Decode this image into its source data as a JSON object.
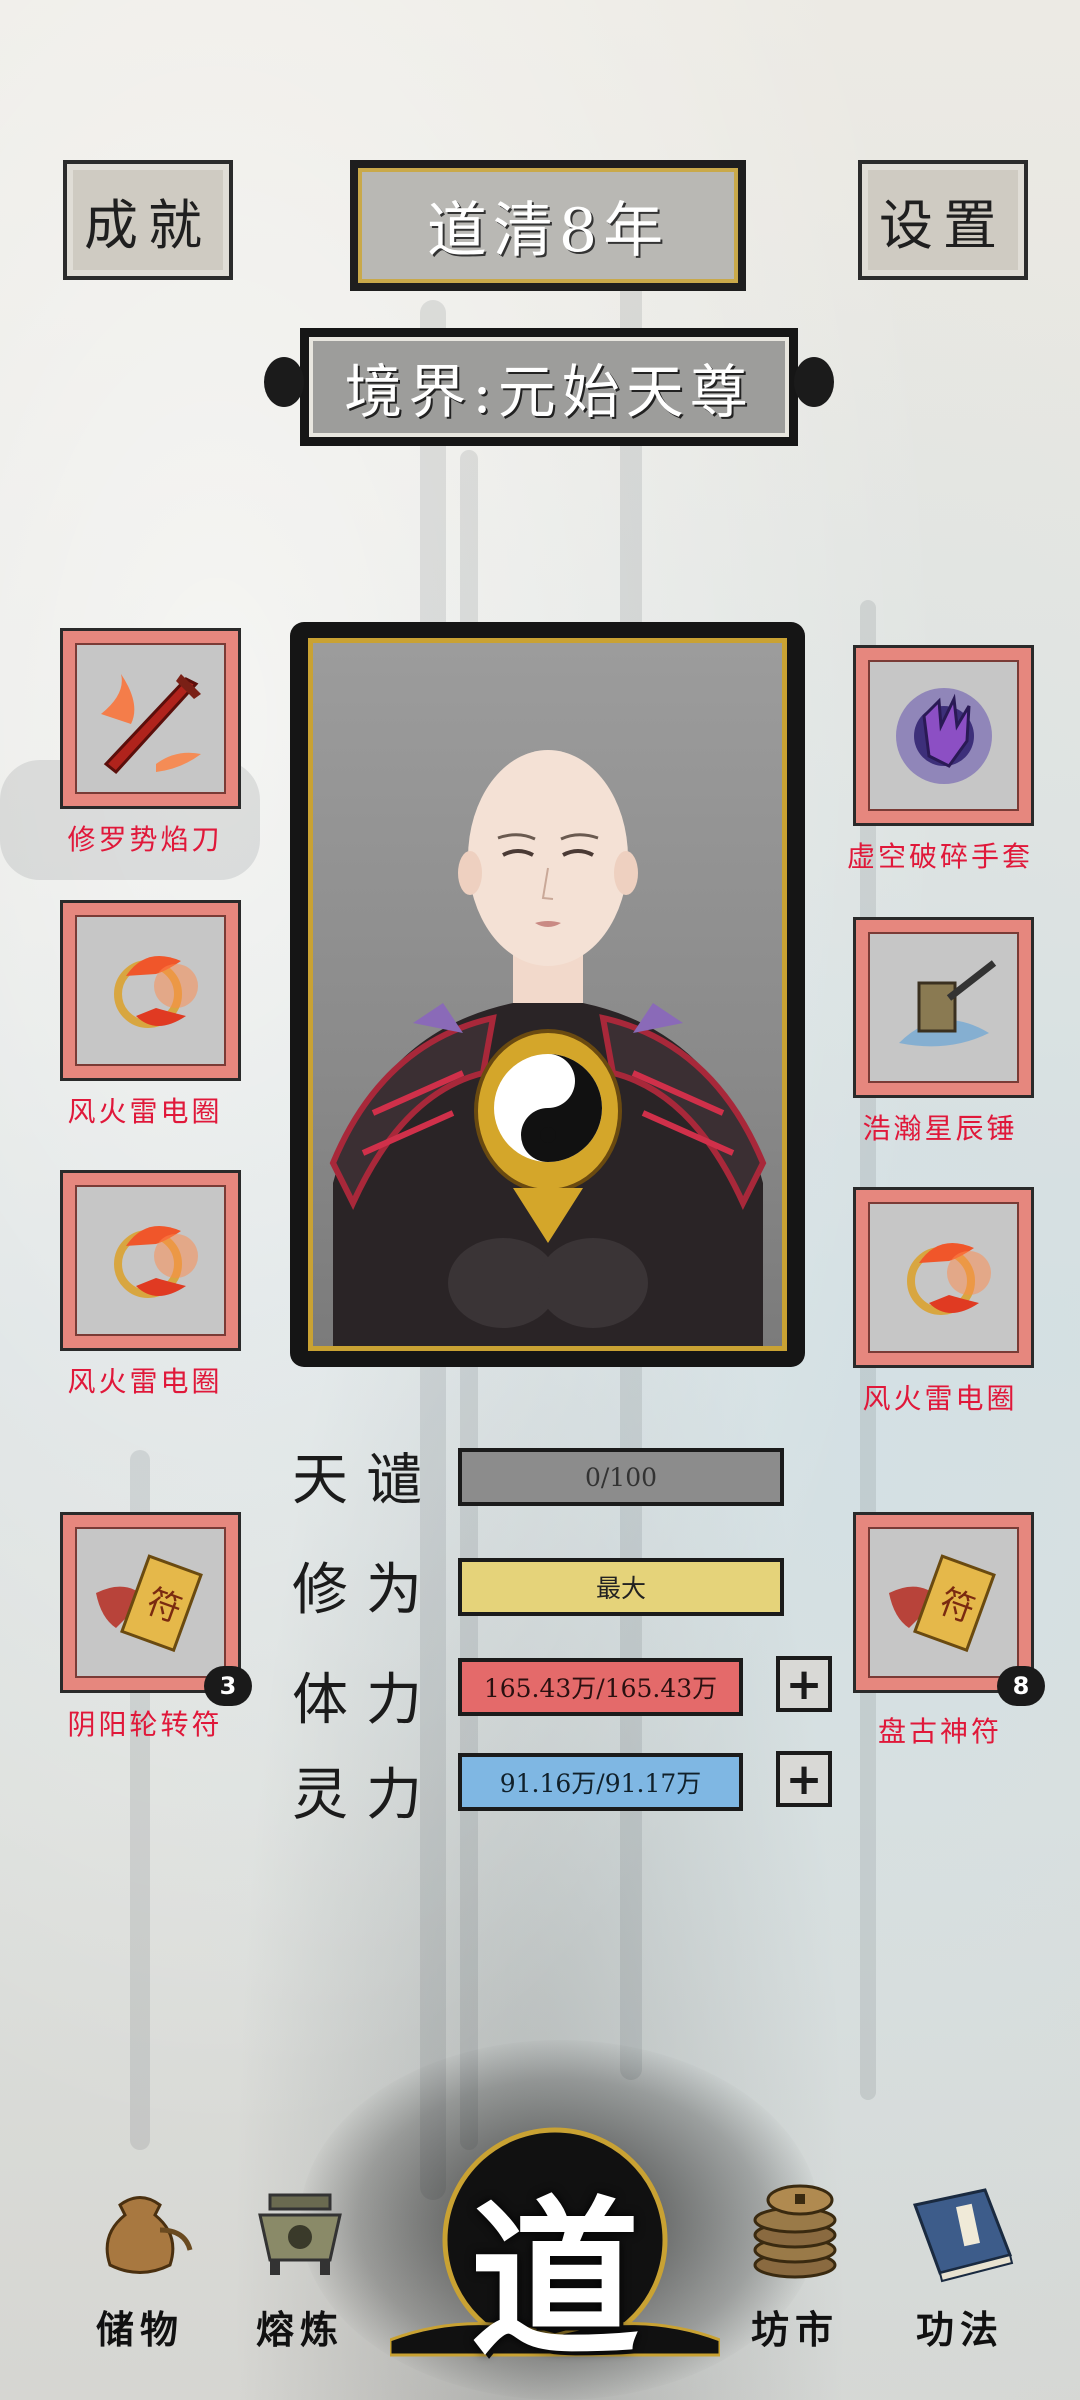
{
  "header": {
    "achievements_label": "成就",
    "year_title": "道清8年",
    "settings_label": "设置",
    "realm": "境界:元始天尊"
  },
  "left_slots": [
    {
      "name": "修罗势焰刀",
      "icon": "flame-sword-icon"
    },
    {
      "name": "风火雷电圈",
      "icon": "fire-ring-icon"
    },
    {
      "name": "风火雷电圈",
      "icon": "fire-ring-icon"
    },
    {
      "name": "阴阳轮转符",
      "icon": "talisman-icon",
      "count": "3"
    }
  ],
  "right_slots": [
    {
      "name": "虚空破碎手套",
      "icon": "void-gauntlet-icon"
    },
    {
      "name": "浩瀚星辰锤",
      "icon": "star-hammer-icon"
    },
    {
      "name": "风火雷电圈",
      "icon": "fire-ring-icon"
    },
    {
      "name": "盘古神符",
      "icon": "talisman-icon",
      "count": "8"
    }
  ],
  "stats": {
    "tribulation": {
      "label": "天谴",
      "value": "0/100",
      "fill": 0.0,
      "color": "#8c8c8c"
    },
    "cultivation": {
      "label": "修为",
      "value": "最大",
      "fill": 1.0,
      "color": "#e5d37a"
    },
    "stamina": {
      "label": "体力",
      "value": "165.43万/165.43万",
      "fill": 1.0,
      "color": "#e46a6a"
    },
    "spirit": {
      "label": "灵力",
      "value": "91.16万/91.17万",
      "fill": 1.0,
      "color": "#7fb7e3"
    }
  },
  "bottom_nav": {
    "storage": "储物",
    "smelting": "熔炼",
    "dao": "道",
    "market": "坊市",
    "skills": "功法"
  }
}
